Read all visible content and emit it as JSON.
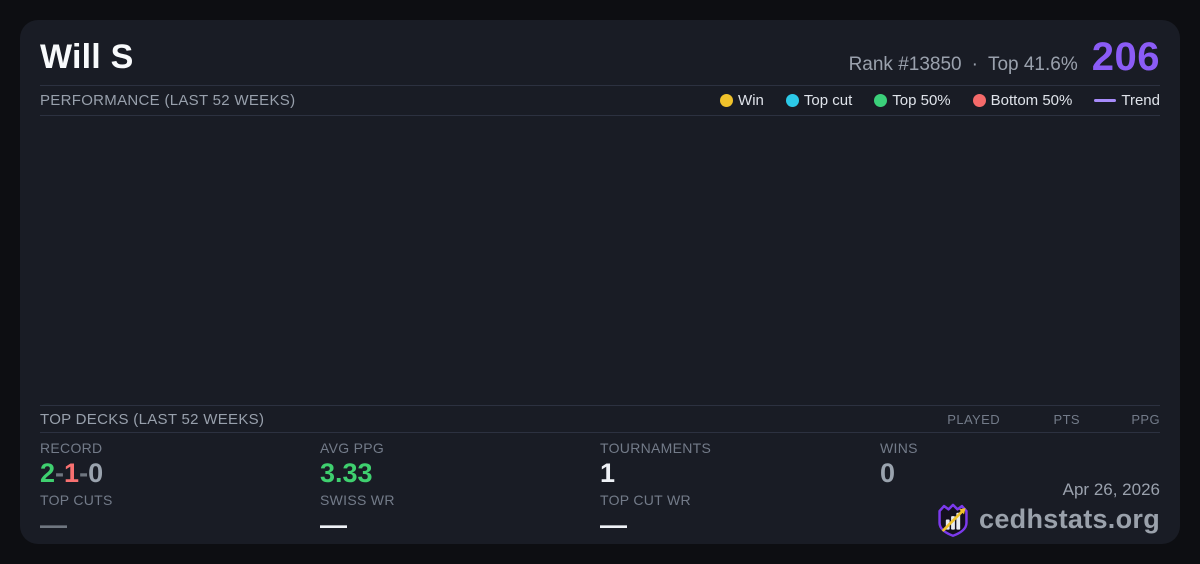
{
  "header": {
    "player_name": "Will S",
    "rank_label": "Rank #13850",
    "separator": "·",
    "top_percent_label": "Top 41.6%",
    "score": "206"
  },
  "performance": {
    "title": "PERFORMANCE (LAST 52 WEEKS)",
    "legend": [
      {
        "label": "Win",
        "color": "#f0c22b"
      },
      {
        "label": "Top cut",
        "color": "#2cc9e8"
      },
      {
        "label": "Top 50%",
        "color": "#3bd07a"
      },
      {
        "label": "Bottom 50%",
        "color": "#f56a6a"
      },
      {
        "label": "Trend",
        "color": "#a78bfa"
      }
    ]
  },
  "top_decks": {
    "title": "TOP DECKS (LAST 52 WEEKS)",
    "columns": [
      "PLAYED",
      "PTS",
      "PPG"
    ]
  },
  "stats": {
    "record": {
      "label": "RECORD",
      "wins": "2",
      "sep": "-",
      "losses": "1",
      "draws": "0"
    },
    "avg_ppg": {
      "label": "AVG PPG",
      "value": "3.33"
    },
    "tournaments": {
      "label": "TOURNAMENTS",
      "value": "1"
    },
    "wins": {
      "label": "WINS",
      "value": "0"
    },
    "top_cuts": {
      "label": "TOP CUTS",
      "value": "—"
    },
    "swiss_wr": {
      "label": "SWISS WR",
      "value": "—"
    },
    "top_cut_wr": {
      "label": "TOP CUT WR",
      "value": "—"
    }
  },
  "footer": {
    "date": "Apr 26, 2026",
    "site": "cedhstats.org"
  },
  "colors": {
    "accent_purple": "#8b5cf6",
    "trend_purple": "#a78bfa",
    "green": "#3fd06f",
    "red": "#f87171",
    "gray_value": "#9aa3ae",
    "bright": "#eef1f6",
    "dash_muted": "#6f7680"
  }
}
